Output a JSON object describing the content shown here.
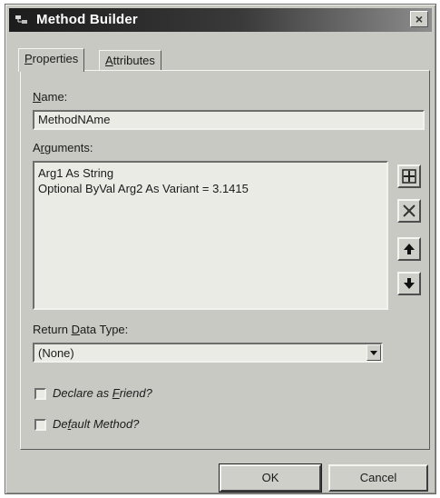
{
  "window": {
    "title": "Method Builder",
    "close_glyph": "×"
  },
  "tabs": [
    {
      "label": "Properties",
      "hotkey": "P",
      "rest": "roperties",
      "active": true
    },
    {
      "label": "Attributes",
      "hotkey": "A",
      "rest": "ttributes",
      "active": false
    }
  ],
  "name": {
    "label_hot": "N",
    "label_rest": "ame:",
    "value": "MethodNAme"
  },
  "arguments": {
    "label_pre": "A",
    "label_hot": "r",
    "label_rest": "guments:",
    "items": [
      "Arg1 As String",
      "Optional ByVal Arg2 As Variant = 3.1415"
    ],
    "buttons": [
      "add-icon",
      "delete-icon",
      "move-up-icon",
      "move-down-icon"
    ]
  },
  "return_type": {
    "label_pre": "Return ",
    "label_hot": "D",
    "label_rest": "ata Type:",
    "value": "(None)"
  },
  "declare_friend": {
    "label_pre": "Declare as ",
    "label_hot": "F",
    "label_rest": "riend?",
    "checked": false
  },
  "default_method": {
    "label_pre": "De",
    "label_hot": "f",
    "label_rest": "ault Method?",
    "checked": false
  },
  "footer": {
    "ok": "OK",
    "cancel": "Cancel"
  }
}
